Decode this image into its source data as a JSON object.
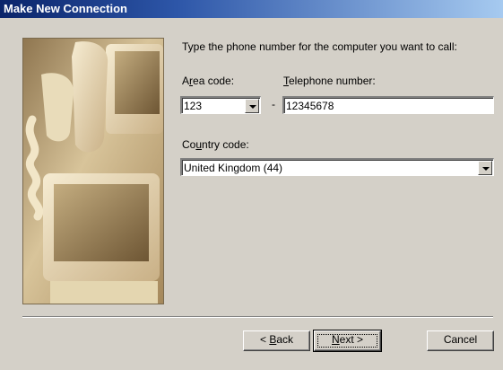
{
  "window": {
    "title": "Make New Connection"
  },
  "instruction": "Type the phone number for the computer you want to call:",
  "area_code": {
    "label_pre": "A",
    "label_accel": "r",
    "label_post": "ea code:",
    "value": "123"
  },
  "dash": "-",
  "telephone": {
    "label_pre": "",
    "label_accel": "T",
    "label_post": "elephone number:",
    "value": "12345678"
  },
  "country": {
    "label_pre": "Co",
    "label_accel": "u",
    "label_post": "ntry code:",
    "value": "United Kingdom (44)"
  },
  "buttons": {
    "back": {
      "pre": "< ",
      "accel": "B",
      "post": "ack"
    },
    "next": {
      "pre": "",
      "accel": "N",
      "post": "ext >"
    },
    "cancel": "Cancel"
  },
  "icons": {
    "dropdown": "chevron-down-icon"
  },
  "colors": {
    "face": "#d4d0c8",
    "title_start": "#0a246a",
    "title_end": "#a6caf0"
  }
}
